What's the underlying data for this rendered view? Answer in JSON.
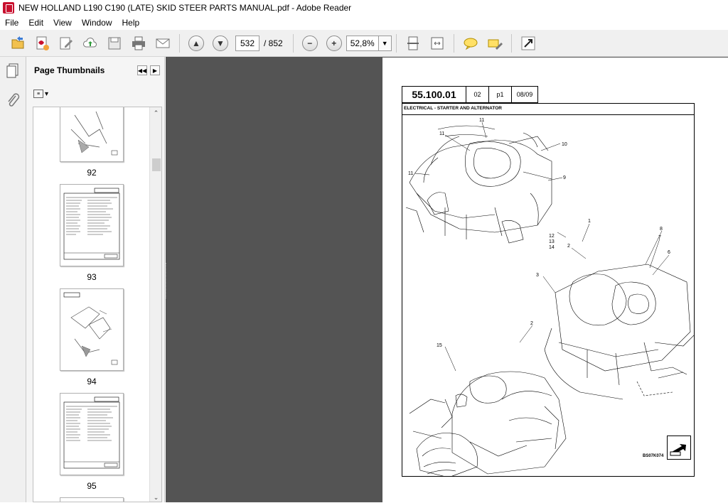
{
  "window": {
    "title": "NEW HOLLAND L190 C190 (LATE) SKID STEER  PARTS MANUAL.pdf - Adobe Reader"
  },
  "menu": [
    "File",
    "Edit",
    "View",
    "Window",
    "Help"
  ],
  "toolbar": {
    "current_page": "532",
    "total_pages": "/ 852",
    "zoom": "52,8%"
  },
  "thumbnails_panel": {
    "title": "Page Thumbnails",
    "pages": [
      "92",
      "93",
      "94",
      "95"
    ]
  },
  "document": {
    "header": {
      "code": "55.100.01",
      "rev": "02",
      "page": "p1",
      "date": "08/09"
    },
    "section_title": "ELECTRICAL - STARTER AND ALTERNATOR",
    "callouts": [
      "11",
      "11",
      "10",
      "11",
      "9",
      "1",
      "2",
      "8",
      "7",
      "6",
      "12",
      "13",
      "14",
      "3",
      "2",
      "15"
    ],
    "drawing_code": "BS07K074"
  }
}
